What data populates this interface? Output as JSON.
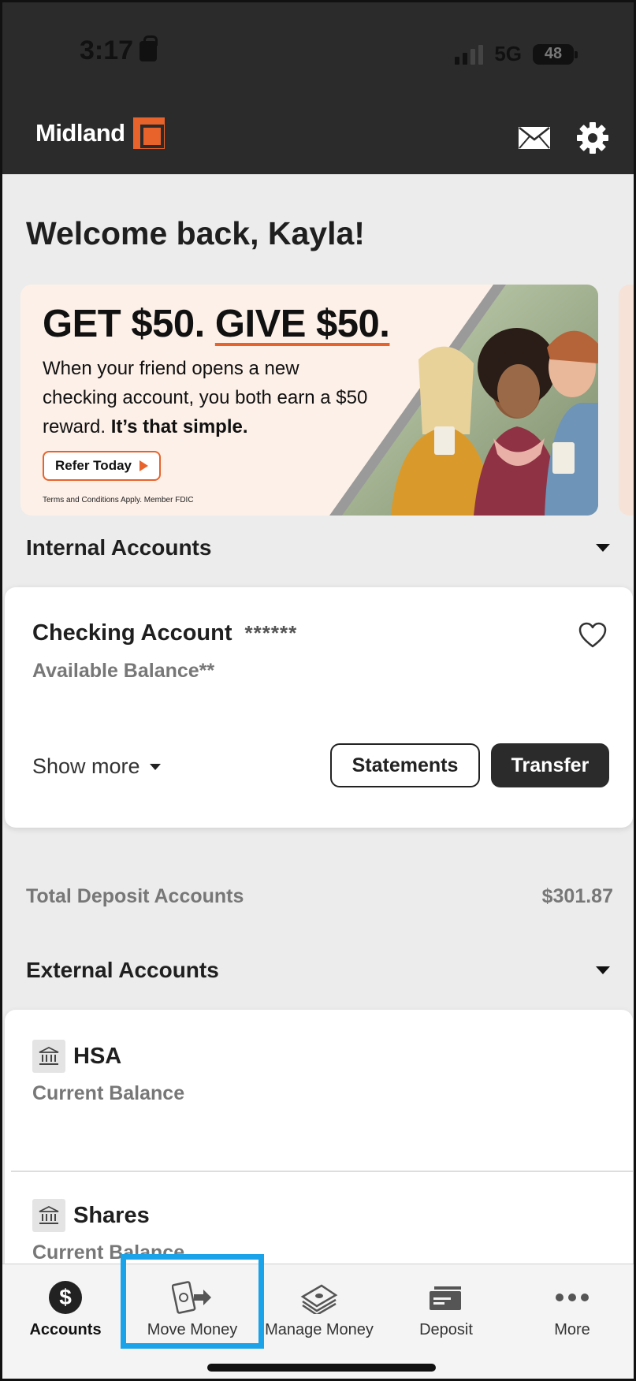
{
  "status_bar": {
    "time": "3:17",
    "network": "5G",
    "battery": "48"
  },
  "header": {
    "brand": "Midland",
    "icons": [
      "mail-icon",
      "gear-icon"
    ]
  },
  "welcome": "Welcome back, Kayla!",
  "promo": {
    "headline_get": "GET $50.",
    "headline_give": "GIVE $50.",
    "body_1": "When your friend opens a new checking account, you both earn a $50 reward. ",
    "body_bold": "It’s that simple.",
    "cta": "Refer Today",
    "terms": "Terms and Conditions Apply. Member FDIC"
  },
  "internal": {
    "title": "Internal Accounts",
    "account": {
      "name": "Checking Account",
      "mask": "******",
      "balance_label": "Available Balance**",
      "show_more": "Show more",
      "statements": "Statements",
      "transfer": "Transfer"
    }
  },
  "total": {
    "label": "Total Deposit Accounts",
    "value": "$301.87"
  },
  "external": {
    "title": "External Accounts",
    "items": [
      {
        "name": "HSA",
        "balance_label": "Current Balance"
      },
      {
        "name": "Shares",
        "balance_label": "Current Balance"
      }
    ]
  },
  "tabs": [
    {
      "label": "Accounts",
      "icon": "dollar-icon",
      "active": true
    },
    {
      "label": "Move Money",
      "icon": "move-money-icon",
      "active": false
    },
    {
      "label": "Manage Money",
      "icon": "manage-money-icon",
      "active": false
    },
    {
      "label": "Deposit",
      "icon": "deposit-icon",
      "active": false
    },
    {
      "label": "More",
      "icon": "more-icon",
      "active": false
    }
  ],
  "colors": {
    "brand_orange": "#e8632b",
    "header_dark": "#2b2b2b",
    "highlight_blue": "#1aa3e8"
  }
}
